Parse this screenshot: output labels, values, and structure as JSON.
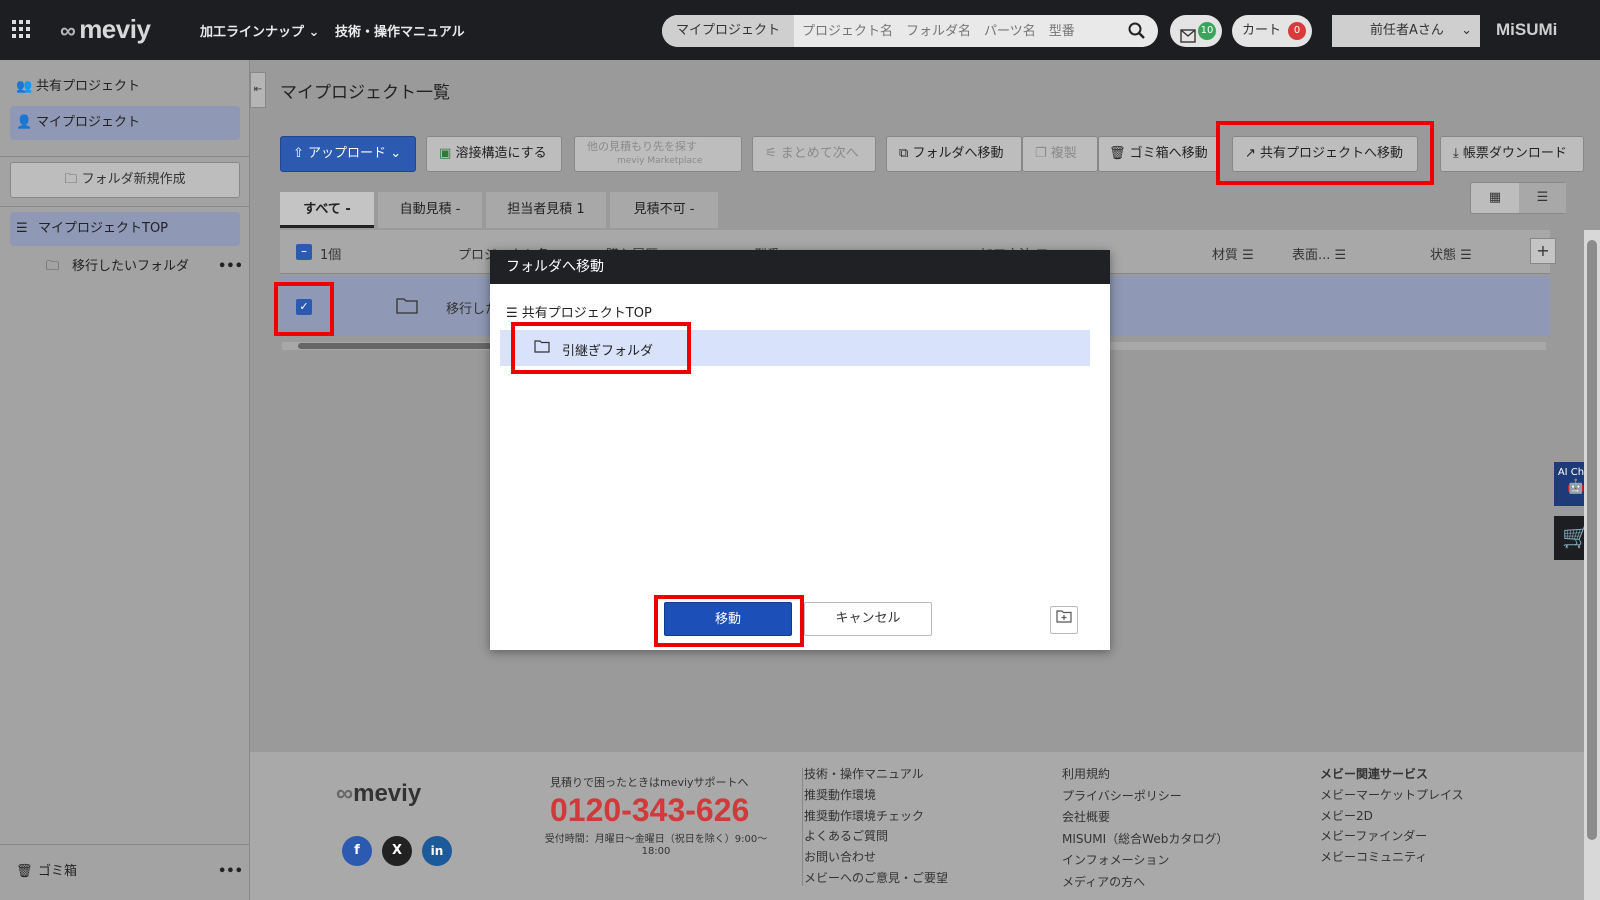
{
  "header": {
    "logo": "meviy",
    "nav": [
      "加工ラインナップ ⌄",
      "技術・操作マニュアル"
    ],
    "search_scope": "マイプロジェクト ⌄",
    "search_placeholder": "プロジェクト名　フォルダ名　パーツ名　型番",
    "mail_count": "10",
    "cart_label": "カート",
    "cart_count": "0",
    "user": "前任者Aさん",
    "brand": "MiSUMi"
  },
  "sidebar": {
    "shared_projects": "共有プロジェクト",
    "my_projects": "マイプロジェクト",
    "new_folder": "フォルダ新規作成",
    "tree_top": "マイプロジェクトTOP",
    "tree_folder": "移行したいフォルダ",
    "trash": "ゴミ箱"
  },
  "main": {
    "title": "マイプロジェクト一覧",
    "toolbar": {
      "upload": "アップロード",
      "weld": "溶接構造にする",
      "estimate_other": "他の見積もり先を探す",
      "estimate_sub": "meviy Marketplace",
      "batch": "まとめて次へ",
      "move_folder": "フォルダへ移動",
      "copy": "複製",
      "trash": "ゴミ箱へ移動",
      "move_shared": "共有プロジェクトへ移動",
      "download": "帳票ダウンロード"
    },
    "tabs": [
      "すべて -",
      "自動見積 -",
      "担当者見積 1",
      "見積不可 -"
    ],
    "table": {
      "count": "1個",
      "headers": [
        "プロジェクト名 ▲",
        "購入履歴 ▲",
        "型番",
        "加工方法 ☰",
        "材質 ☰",
        "表面... ☰",
        "状態 ☰"
      ],
      "row_name": "移行したいフォルダ"
    }
  },
  "modal": {
    "title": "フォルダへ移動",
    "tree_root": "共有プロジェクトTOP",
    "selected_folder": "引継ぎフォルダ",
    "move_button": "移動",
    "cancel_button": "キャンセル"
  },
  "footer": {
    "logo": "meviy",
    "support_text": "見積りで困ったときはmeviyサポートへ",
    "phone": "0120-343-626",
    "hours": "受付時間：月曜日〜金曜日（祝日を除く）9:00〜18:00",
    "col1": [
      "技術・操作マニュアル",
      "推奨動作環境",
      "推奨動作環境チェック",
      "よくあるご質問",
      "お問い合わせ",
      "メビーへのご意見・ご要望"
    ],
    "col2": [
      "利用規約",
      "プライバシーポリシー",
      "会社概要",
      "MISUMI（総合Webカタログ）",
      "インフォメーション",
      "メディアの方へ"
    ],
    "col3_title": "メビー関連サービス",
    "col3": [
      "メビーマーケットプレイス",
      "メビー2D",
      "メビーファインダー",
      "メビーコミュニティ"
    ]
  },
  "side_widgets": {
    "ai_chat": "AI Chat"
  },
  "colors": {
    "primary": "#1d4fb8",
    "highlight": "#ee0000",
    "phone": "#d03a3a"
  }
}
